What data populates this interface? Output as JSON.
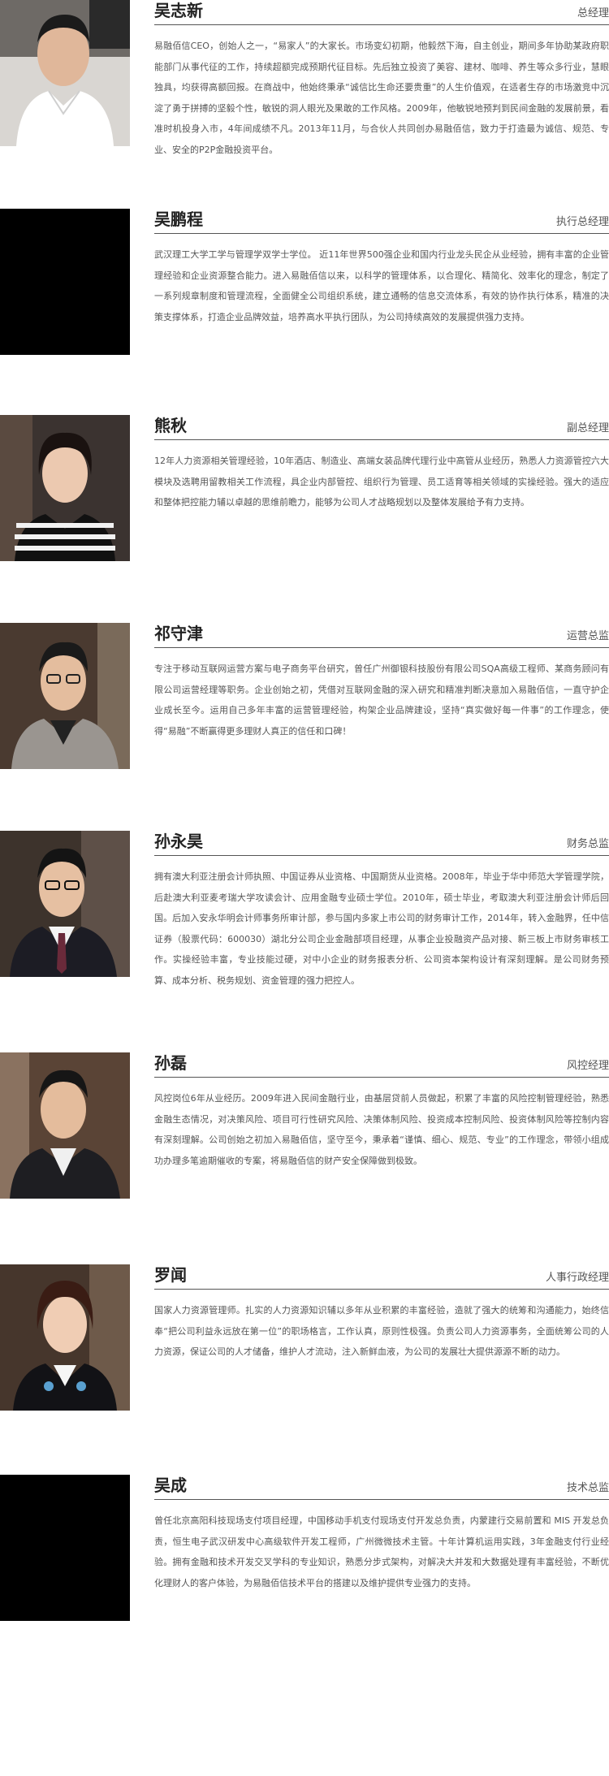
{
  "profiles": [
    {
      "name": "吴志新",
      "title": "总经理",
      "photo": "portrait-man-white-shirt",
      "bio": "易融佰信CEO，创始人之一，“易家人”的大家长。市场变幻初期，他毅然下海，自主创业，期间多年协助某政府职能部门从事代征的工作，持续超额完成预期代征目标。先后独立投资了美容、建材、咖啡、养生等众多行业，慧眼独具，均获得高额回报。在商战中，他始终秉承“诚信比生命还要贵重”的人生价值观，在适者生存的市场激竞中沉淀了勇于拼搏的坚毅个性，敏锐的洞人眼光及果敢的工作风格。2009年，他敏锐地预判到民间金融的发展前景，看准时机投身入市，4年间成绩不凡。2013年11月，与合伙人共同创办易融佰信，致力于打造最为诚信、规范、专业、安全的P2P金融投资平台。"
    },
    {
      "name": "吴鹏程",
      "title": "执行总经理",
      "photo": "none",
      "bio": "武汉理工大学工学与管理学双学士学位。 近11年世界500强企业和国内行业龙头民企从业经验，拥有丰富的企业管理经验和企业资源整合能力。进入易融佰信以来，以科学的管理体系，以合理化、精简化、效率化的理念，制定了一系列规章制度和管理流程，全面健全公司组织系统，建立通畅的信息交流体系，有效的协作执行体系，精准的决策支撑体系，打造企业品牌效益，培养高水平执行团队，为公司持续高效的发展提供强力支持。"
    },
    {
      "name": "熊秋",
      "title": "副总经理",
      "photo": "portrait-woman-striped-top",
      "bio": "12年人力资源相关管理经验，10年酒店、制造业、高端女装品牌代理行业中高管从业经历，熟悉人力资源管控六大模块及选聘用留教相关工作流程，具企业内部管控、组织行为管理、员工适育等相关领域的实操经验。强大的适应和整体把控能力辅以卓越的思维前瞻力，能够为公司人才战略规划以及整体发展给予有力支持。"
    },
    {
      "name": "祁守津",
      "title": "运营总监",
      "photo": "portrait-man-glasses-blazer",
      "bio": "专注于移动互联网运营方案与电子商务平台研究，曾任广州御银科技股份有限公司SQA高级工程师、某商务顾问有限公司运营经理等职务。企业创始之初，凭借对互联网金融的深入研究和精准判断决意加入易融佰信，一直守护企业成长至今。运用自己多年丰富的运营管理经验，构架企业品牌建设，坚持“真实做好每一件事”的工作理念，使得“易融”不断赢得更多理财人真正的信任和口碑！"
    },
    {
      "name": "孙永昊",
      "title": "财务总监",
      "photo": "portrait-man-glasses-suit-tie",
      "bio": "拥有澳大利亚注册会计师执照、中国证券从业资格、中国期货从业资格。2008年，毕业于华中师范大学管理学院，后赴澳大利亚麦考瑞大学攻读会计、应用金融专业硕士学位。2010年，硕士毕业，考取澳大利亚注册会计师后回国。后加入安永华明会计师事务所审计部，参与国内多家上市公司的财务审计工作，2014年，转入金融界，任中信证券（股票代码：600030）湖北分公司企业金融部项目经理，从事企业投融资产品对接、新三板上市财务审核工作。实操经验丰富，专业技能过硬，对中小企业的财务报表分析、公司资本架构设计有深刻理解。是公司财务预算、成本分析、税务规划、资金管理的强力把控人。"
    },
    {
      "name": "孙磊",
      "title": "风控经理",
      "photo": "portrait-man-suit",
      "bio": "风控岗位6年从业经历。2009年进入民间金融行业，由基层贷前人员做起，积累了丰富的风险控制管理经验，熟悉金融生态情况，对决策风险、项目可行性研究风险、决策体制风险、投资成本控制风险、投资体制风险等控制内容有深刻理解。公司创始之初加入易融佰信，坚守至今，秉承着“谨慎、细心、规范、专业”的工作理念，带领小组成功办理多笔逾期催收的专案，将易融佰信的财产安全保障做到极致。"
    },
    {
      "name": "罗闻",
      "title": "人事行政经理",
      "photo": "portrait-woman-blazer",
      "bio": "国家人力资源管理师。扎实的人力资源知识辅以多年从业积累的丰富经验，造就了强大的统筹和沟通能力，始终信奉“把公司利益永远放在第一位”的职场格言，工作认真，原则性极强。负责公司人力资源事务，全面统筹公司的人力资源，保证公司的人才储备，维护人才流动，注入新鲜血液，为公司的发展壮大提供源源不断的动力。"
    },
    {
      "name": "吴成",
      "title": "技术总监",
      "photo": "none",
      "bio": "曾任北京高阳科技现场支付项目经理，中国移动手机支付现场支付开发总负责，内蒙建行交易前置和 MIS 开发总负责，恒生电子武汉研发中心高级软件开发工程师，广州微微技术主管。十年计算机运用实践，3年金融支付行业经验。拥有金融和技术开发交叉学科的专业知识，熟悉分步式架构，对解决大并发和大数据处理有丰富经验，不断优化理财人的客户体验，为易融佰信技术平台的搭建以及维护提供专业强力的支持。"
    }
  ]
}
